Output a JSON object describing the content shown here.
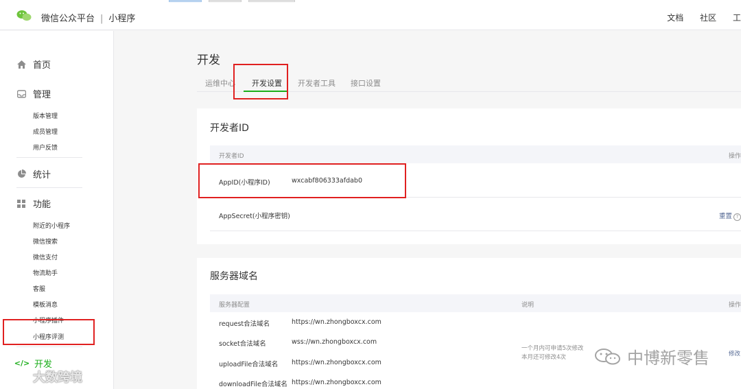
{
  "header": {
    "brand": "微信公众平台",
    "separator": "|",
    "product": "小程序",
    "links": [
      "文档",
      "社区",
      "工具"
    ]
  },
  "sidebar": {
    "home": "首页",
    "manage": {
      "label": "管理",
      "items": [
        "版本管理",
        "成员管理",
        "用户反馈"
      ]
    },
    "stats": "统计",
    "features": {
      "label": "功能",
      "items": [
        "附近的小程序",
        "微信搜索",
        "微信支付",
        "物流助手",
        "客服",
        "模板消息",
        "小程序插件",
        "小程序评测"
      ]
    },
    "develop": "开发",
    "develop_icon": "</>"
  },
  "main": {
    "title": "开发",
    "tabs": [
      "运维中心",
      "开发设置",
      "开发者工具",
      "接口设置"
    ],
    "active_tab": "开发设置",
    "developer_id": {
      "title": "开发者ID",
      "header_col1": "开发者ID",
      "header_action": "操作",
      "rows": [
        {
          "label": "AppID(小程序ID)",
          "value": "wxcabf806333afdab0"
        },
        {
          "label": "AppSecret(小程序密钥)",
          "value": "",
          "action": "重置"
        }
      ]
    },
    "server_domain": {
      "title": "服务器域名",
      "header_col1": "服务器配置",
      "header_col2": "说明",
      "header_action": "操作",
      "rows": [
        {
          "label": "request合法域名",
          "value": "https://wn.zhongboxcx.com"
        },
        {
          "label": "socket合法域名",
          "value": "wss://wn.zhongboxcx.com"
        },
        {
          "label": "uploadFile合法域名",
          "value": "https://wn.zhongboxcx.com"
        },
        {
          "label": "downloadFile合法域名",
          "value": "https://wn.zhongboxcx.com"
        }
      ],
      "note_line1": "一个月内可申请5次修改",
      "note_line2": "本月还可修改4次",
      "action": "修改"
    }
  },
  "watermarks": {
    "right": "中博新零售",
    "left": "大数跨境"
  },
  "colors": {
    "accent_green": "#1aad19",
    "highlight_red": "#e02020",
    "link_blue": "#576b95"
  }
}
